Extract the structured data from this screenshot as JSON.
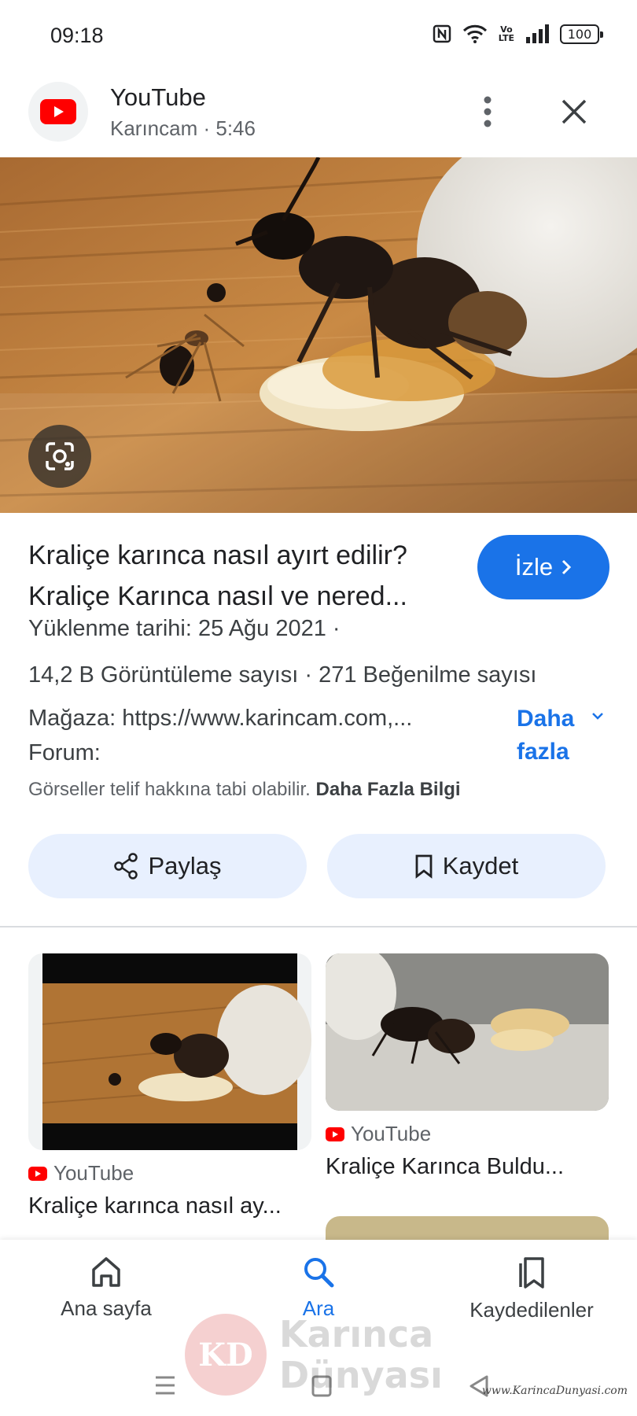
{
  "status_bar": {
    "time": "09:18",
    "battery": "100",
    "volte_line1": "Vo",
    "volte_line2": "LTE",
    "icons": [
      "nfc-icon",
      "wifi-icon",
      "volte-icon",
      "signal-icon",
      "battery-icon"
    ]
  },
  "header": {
    "source": "YouTube",
    "channel": "Karıncam · 5:46"
  },
  "video": {
    "title_line1": "Kraliçe karınca nasıl ayırt edilir?",
    "title_line2": "Kraliçe Karınca nasıl ve nered...",
    "watch_label": "İzle",
    "upload": "Yüklenme tarihi: 25 Ağu 2021  ·",
    "views_likes": "14,2 B Görüntüleme sayısı  ·  271 Beğenilme sayısı",
    "store": "Mağaza: https://www.karincam.com,...",
    "forum": "Forum:",
    "more_label": "Daha fazla",
    "copyright_text": "Görseller telif hakkına tabi olabilir.",
    "copyright_link": "Daha Fazla Bilgi"
  },
  "actions": {
    "share": "Paylaş",
    "save": "Kaydet"
  },
  "related": [
    {
      "source": "YouTube",
      "title": "Kraliçe karınca nasıl ay..."
    },
    {
      "source": "YouTube",
      "title": "Kraliçe Karınca Buldu..."
    }
  ],
  "bottom_nav": {
    "home": "Ana sayfa",
    "search": "Ara",
    "saved": "Kaydedilenler"
  },
  "watermark": {
    "logo_text": "KD",
    "line1": "Karınca",
    "line2": "Dünyası",
    "url": "www.KarincaDunyasi.com"
  },
  "colors": {
    "accent": "#1a73e8",
    "youtube_red": "#ff0000",
    "chip_bg": "#e8f0fe"
  }
}
